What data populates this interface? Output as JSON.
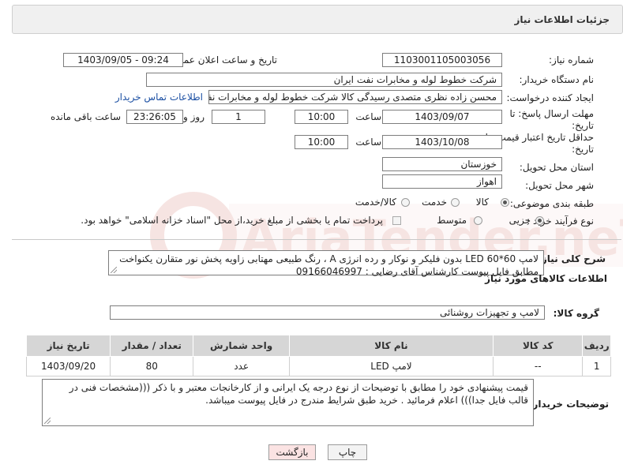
{
  "header": {
    "title": "جزئیات اطلاعات نیاز"
  },
  "fields": {
    "need_number_label": "شماره نیاز:",
    "need_number": "1103001105003056",
    "announce_label": "تاریخ و ساعت اعلان عمومی:",
    "announce_value": "1403/09/05 - 09:24",
    "buyer_org_label": "نام دستگاه خریدار:",
    "buyer_org": "شرکت خطوط لوله و مخابرات نفت ایران",
    "creator_label": "ایجاد کننده درخواست:",
    "creator": "محسن زاده نظری متصدی رسیدگی کالا شرکت خطوط لوله و مخابرات نفت ایران",
    "contact_link": "اطلاعات تماس خریدار",
    "deadline_label_1": "مهلت ارسال پاسخ: تا",
    "deadline_label_2": "تاریخ:",
    "deadline_date": "1403/09/07",
    "time_label": "ساعت",
    "deadline_time": "10:00",
    "days_value": "1",
    "days_label": "روز و",
    "remaining_time": "23:26:05",
    "remaining_label": "ساعت باقی مانده",
    "validity_label_1": "حداقل تاریخ اعتبار قیمت: تا",
    "validity_label_2": "تاریخ:",
    "validity_date": "1403/10/08",
    "validity_time_label": "ساعت",
    "validity_time": "10:00",
    "province_label": "استان محل تحویل:",
    "province": "خوزستان",
    "city_label": "شهر محل تحویل:",
    "city": "اهواز",
    "category_label": "طبقه بندی موضوعی:",
    "category_options": [
      "کالا",
      "خدمت",
      "کالا/خدمت"
    ],
    "purchase_type_label": "نوع فرآیند خرید :",
    "purchase_options": [
      "جزیی",
      "متوسط"
    ],
    "payment_note": "پرداخت تمام یا بخشی از مبلغ خرید،از محل \"اسناد خزانه اسلامی\" خواهد بود."
  },
  "description": {
    "label": "شرح کلی نیاز:",
    "text": "لامپ 60*60 LED بدون فلیکر و نوکار و رده انرژی A ، رنگ طبیعی مهتابی زاویه پخش نور متقارن یکنواخت مطابق فایل پیوست کارشناس آقای رضایی : 09166046997"
  },
  "goods_section": {
    "title": "اطلاعات کالاهای مورد نیاز",
    "group_label": "گروه کالا:",
    "group_value": "لامپ و تجهیزات روشنائی"
  },
  "table": {
    "headers": [
      "ردیف",
      "کد کالا",
      "نام کالا",
      "واحد شمارش",
      "تعداد / مقدار",
      "تاریخ نیاز"
    ],
    "rows": [
      [
        "1",
        "--",
        "لامپ LED",
        "عدد",
        "80",
        "1403/09/20"
      ]
    ]
  },
  "buyer_notes": {
    "label": "توضیحات خریدار:",
    "text": "قیمت پیشنهادی خود را مطابق با توضیحات از نوع درجه یک ایرانی و از کارخانجات معتبر و با ذکر (((مشخصات فنی در قالب فایل جدا))) اعلام فرمائید . خرید طبق شرایط مندرج در فایل پیوست میباشد."
  },
  "buttons": {
    "print": "چاپ",
    "back": "بازگشت"
  },
  "colors": {
    "panel_bg": "#f0f0f0",
    "table_header_bg": "#d6d6d6",
    "link": "#1b4fa3",
    "back_button_bg": "#fbe3e3"
  }
}
